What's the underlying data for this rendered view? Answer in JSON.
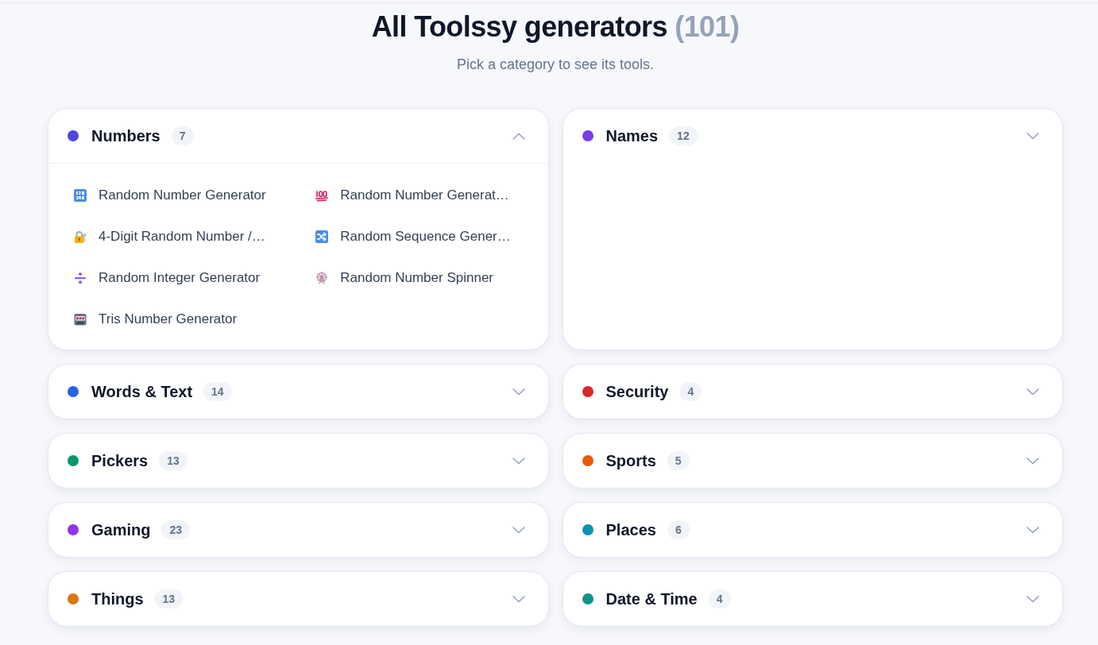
{
  "page": {
    "title": "All Toolssy generators",
    "total": "(101)",
    "subtitle": "Pick a category to see its tools."
  },
  "categories": [
    {
      "name": "Numbers",
      "count": "7",
      "color": "#4f46e5",
      "expanded": true,
      "tools": [
        {
          "label": "Random Number Generator"
        },
        {
          "label": "Random Number Generat…"
        },
        {
          "label": "4-Digit Random Number /…"
        },
        {
          "label": "Random Sequence Gener…"
        },
        {
          "label": "Random Integer Generator"
        },
        {
          "label": "Random Number Spinner"
        },
        {
          "label": "Tris Number Generator"
        }
      ]
    },
    {
      "name": "Names",
      "count": "12",
      "color": "#7c3aed",
      "expanded": false
    },
    {
      "name": "Words & Text",
      "count": "14",
      "color": "#2563eb",
      "expanded": false
    },
    {
      "name": "Security",
      "count": "4",
      "color": "#dc2626",
      "expanded": false
    },
    {
      "name": "Pickers",
      "count": "13",
      "color": "#059669",
      "expanded": false
    },
    {
      "name": "Sports",
      "count": "5",
      "color": "#ea580c",
      "expanded": false
    },
    {
      "name": "Gaming",
      "count": "23",
      "color": "#9333ea",
      "expanded": false
    },
    {
      "name": "Places",
      "count": "6",
      "color": "#0891b2",
      "expanded": false
    },
    {
      "name": "Things",
      "count": "13",
      "color": "#d97706",
      "expanded": false
    },
    {
      "name": "Date & Time",
      "count": "4",
      "color": "#0d9488",
      "expanded": false
    }
  ]
}
